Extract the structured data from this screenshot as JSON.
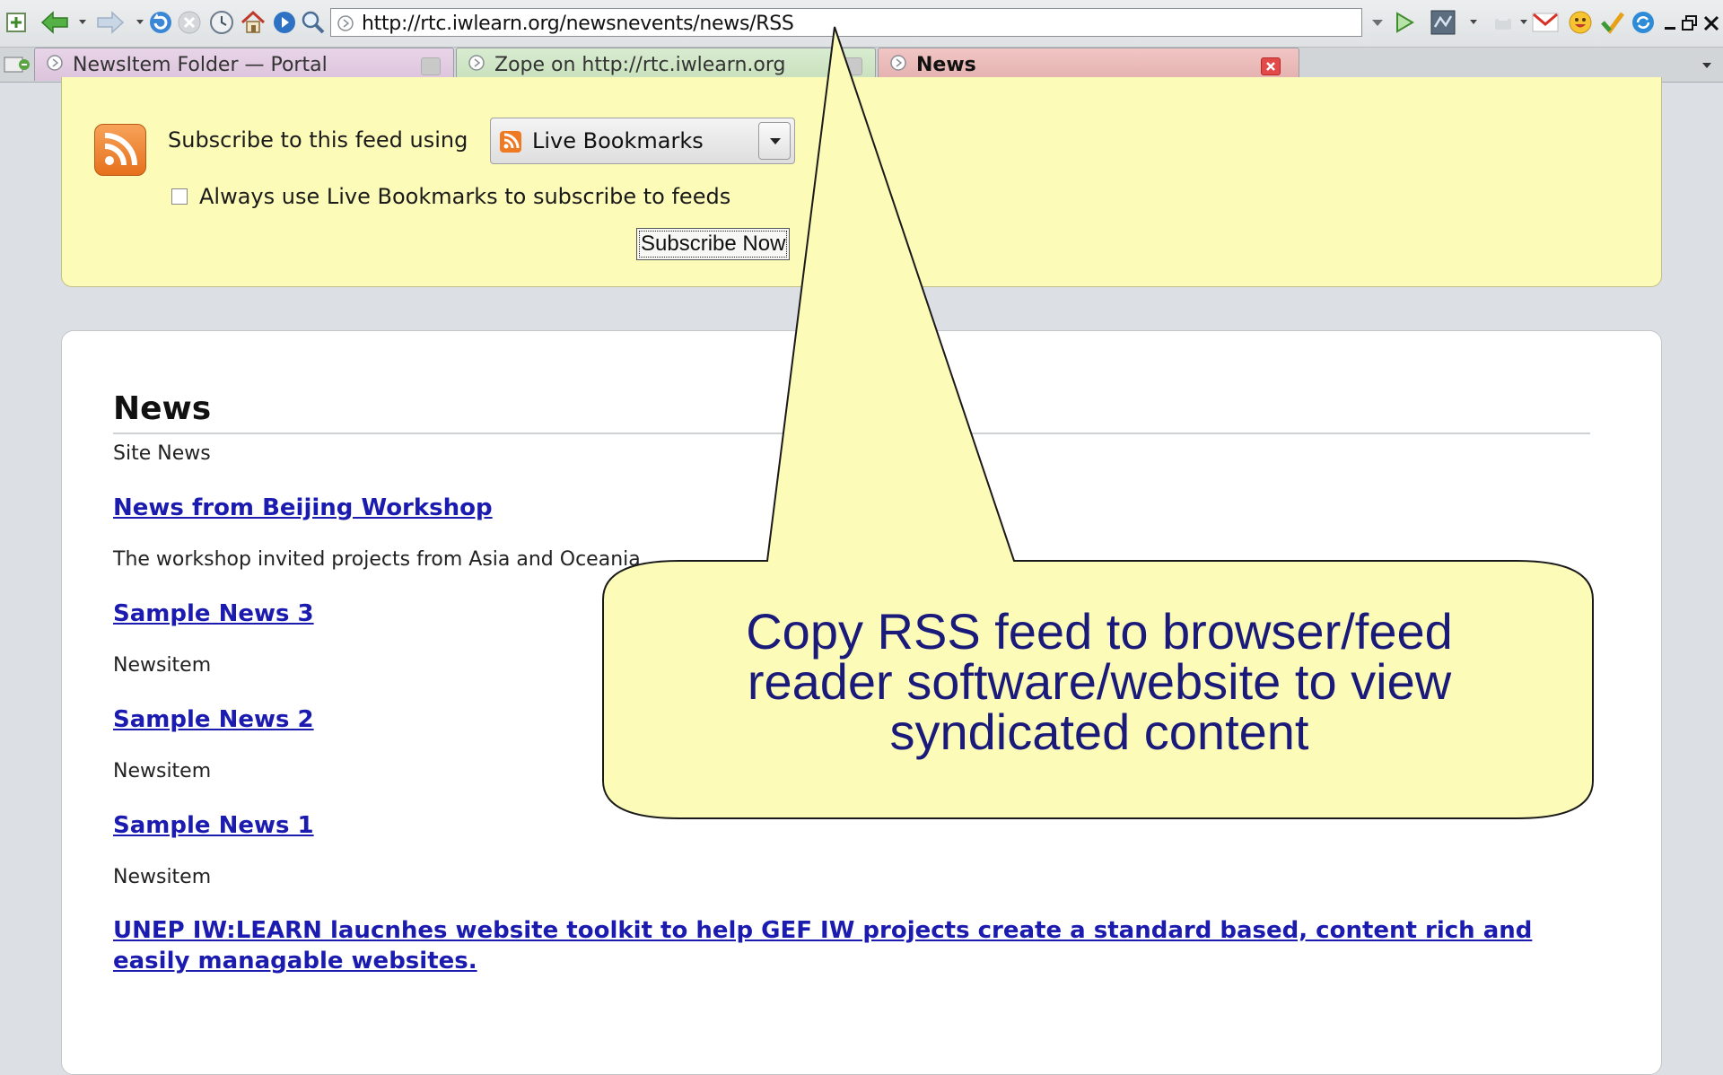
{
  "browser": {
    "url": "http://rtc.iwlearn.org/newsnevents/news/RSS",
    "tabs": [
      {
        "label": "NewsItem Folder — Portal",
        "active": false,
        "color": "#e2cce2"
      },
      {
        "label": "Zope on http://rtc.iwlearn.org",
        "active": false,
        "color": "#d0e6c6"
      },
      {
        "label": "News",
        "active": true,
        "color": "#ebbbb9"
      }
    ]
  },
  "feed": {
    "subscribe_label": "Subscribe to this feed using",
    "reader_selected": "Live Bookmarks",
    "always_checkbox_label": "Always use Live Bookmarks to subscribe to feeds",
    "always_checked": false,
    "subscribe_button": "Subscribe Now"
  },
  "news": {
    "title": "News",
    "description": "Site News",
    "items": [
      {
        "title": "News from Beijing Workshop",
        "description": "The workshop invited projects from Asia and Oceania"
      },
      {
        "title": "Sample News 3",
        "description": "Newsitem"
      },
      {
        "title": "Sample News 2",
        "description": "Newsitem"
      },
      {
        "title": "Sample News 1",
        "description": "Newsitem"
      },
      {
        "title": "UNEP IW:LEARN laucnhes website toolkit to help GEF IW projects create a standard based, content rich and easily managable websites.",
        "description": ""
      }
    ]
  },
  "callout": {
    "text_lines": [
      "Copy RSS feed to browser/feed",
      "reader software/website to view",
      "syndicated content"
    ],
    "fill": "#fdfbb8",
    "text_color": "#1a1a7a"
  },
  "colors": {
    "link": "#1b1bb0",
    "feed_bg": "#fdfbb8",
    "rss_orange": "#ee7a24"
  }
}
